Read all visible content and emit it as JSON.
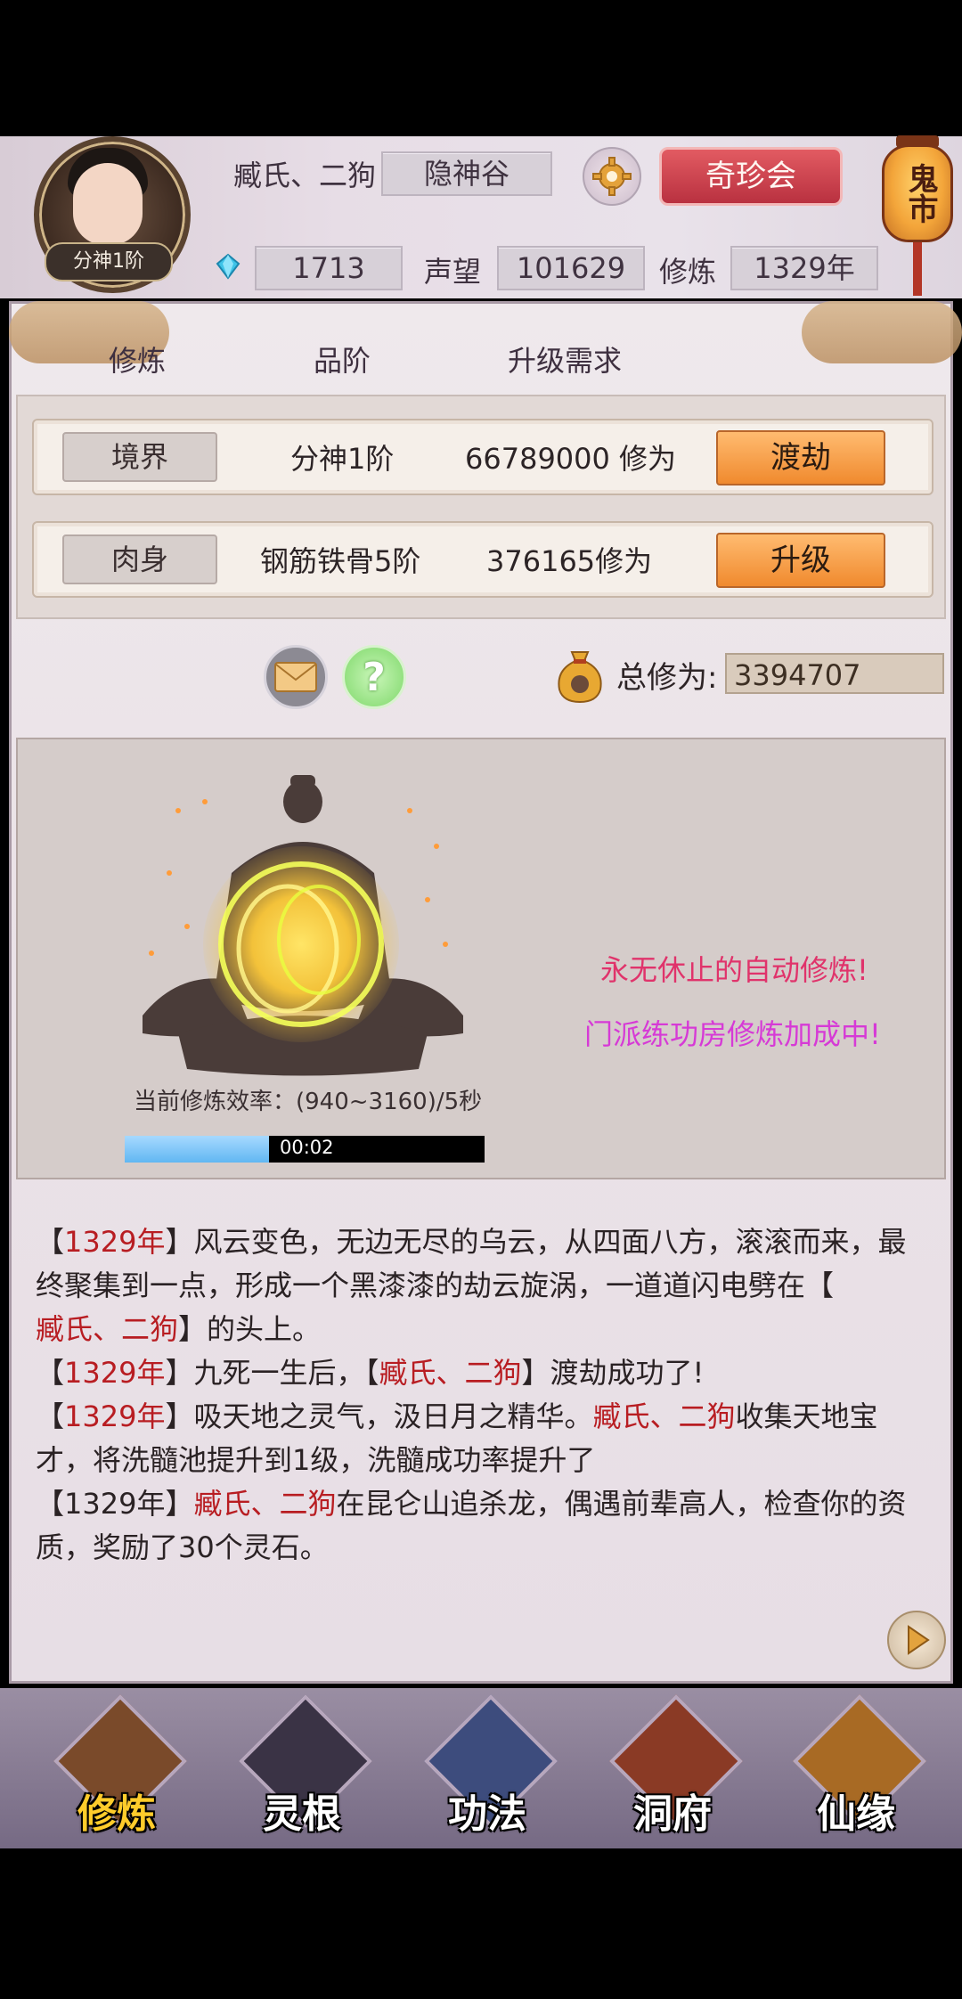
{
  "header": {
    "player_name": "臧氏、二狗",
    "sect": "隐神谷",
    "rank_badge": "分神1阶",
    "gems": "1713",
    "reputation_label": "声望",
    "reputation": "101629",
    "cultivation_label": "修炼",
    "cultivation_years": "1329年",
    "treasure_button": "奇珍会",
    "lantern_label": "鬼市"
  },
  "tabs": {
    "col1": "修炼",
    "col2": "品阶",
    "col3": "升级需求"
  },
  "rows": [
    {
      "tag": "境界",
      "stage": "分神1阶",
      "requirement": "66789000 修为",
      "action": "渡劫"
    },
    {
      "tag": "肉身",
      "stage": "钢筋铁骨5阶",
      "requirement": "376165修为",
      "action": "升级"
    }
  ],
  "total": {
    "label": "总修为:",
    "value": "3394707"
  },
  "stage": {
    "auto_text": "永无休止的自动修炼!",
    "bonus_text": "门派练功房修炼加成中!",
    "efficiency": "当前修炼效率：(940~3160)/5秒",
    "timer": "00:02",
    "progress_fraction": 0.4
  },
  "log": {
    "l1_year": "1329年",
    "l1_text": "风云变色，无边无尽的乌云，从四面八方，滚滚而来，最终聚集到一点，形成一个黑漆漆的劫云旋涡，一道道闪电劈在【",
    "l1_name": "臧氏、二狗",
    "l1_tail": "】的头上。",
    "l2_year": "1329年",
    "l2_text": "九死一生后，【",
    "l2_name": "臧氏、二狗",
    "l2_tail": "】渡劫成功了!",
    "l3_year": "1329年",
    "l3_text": "吸天地之灵气，汲日月之精华。",
    "l3_name": "臧氏、二狗",
    "l3_tail": "收集天地宝才，将洗髓池提升到1级，洗髓成功率提升了",
    "l4_year": "1329年",
    "l4_name": "臧氏、二狗",
    "l4_tail": "在昆仑山追杀龙，偶遇前辈高人，检查你的资质，奖励了30个灵石。"
  },
  "nav": [
    {
      "label": "修炼"
    },
    {
      "label": "灵根"
    },
    {
      "label": "功法"
    },
    {
      "label": "洞府"
    },
    {
      "label": "仙缘"
    }
  ],
  "colors": {
    "accent_red": "#b81d22",
    "pink_text": "#e0336b",
    "magenta_text": "#d63ad6",
    "orange_button": "#f08a2e"
  }
}
